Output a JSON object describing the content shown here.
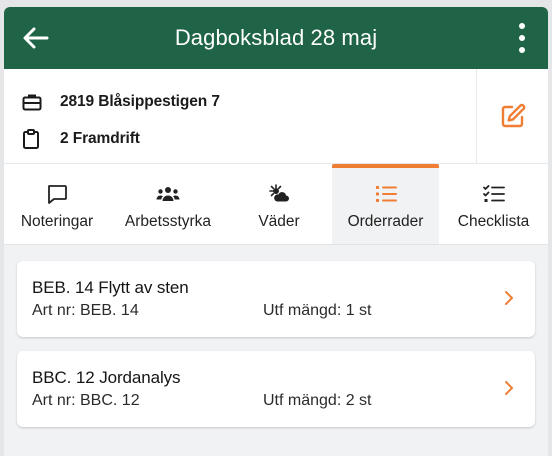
{
  "header": {
    "title": "Dagboksblad 28 maj",
    "back_icon": "arrow-left-icon",
    "menu_icon": "kebab-menu-icon",
    "background": "#1f6446"
  },
  "info": {
    "project": "2819 Blåsippestigen 7",
    "project_icon": "briefcase-icon",
    "stage": "2 Framdrift",
    "stage_icon": "clipboard-icon",
    "edit_icon": "edit-icon"
  },
  "tabs": [
    {
      "label": "Noteringar",
      "icon": "comment-icon"
    },
    {
      "label": "Arbetsstyrka",
      "icon": "users-icon"
    },
    {
      "label": "Väder",
      "icon": "weather-sun-cloud-icon"
    },
    {
      "label": "Orderrader",
      "icon": "list-icon",
      "active": true
    },
    {
      "label": "Checklista",
      "icon": "checklist-icon"
    }
  ],
  "orders": [
    {
      "title": "BEB. 14 Flytt av sten",
      "art": "Art nr: BEB. 14",
      "qty": "Utf mängd: 1 st"
    },
    {
      "title": "BBC. 12 Jordanalys",
      "art": "Art nr: BBC. 12",
      "qty": "Utf mängd: 2 st"
    }
  ],
  "colors": {
    "accent": "#ef7e34",
    "primary": "#1f6446"
  }
}
